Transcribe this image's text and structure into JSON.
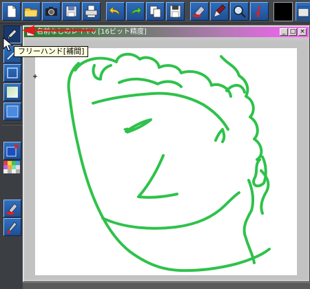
{
  "window": {
    "title": "名前なしのレイヤ0 [16ビット精度]",
    "minimize_glyph": "_",
    "maximize_glyph": "□",
    "close_glyph": "×"
  },
  "tooltip": {
    "text": "フリーハンド[補間]"
  },
  "toolbar": {
    "buttons": [
      {
        "icon": "new-document-icon"
      },
      {
        "icon": "open-folder-icon"
      },
      {
        "icon": "camera-icon"
      },
      {
        "icon": "save-disk-icon"
      },
      {
        "icon": "printer-icon"
      },
      {
        "icon": "undo-icon"
      },
      {
        "icon": "redo-icon"
      },
      {
        "icon": "copy-layer-icon"
      },
      {
        "icon": "save-layer-icon"
      },
      {
        "icon": "eraser-icon"
      },
      {
        "icon": "pen-icon"
      },
      {
        "icon": "magnifier-icon"
      },
      {
        "icon": "text-tool-icon"
      }
    ],
    "current_color": "#000000"
  },
  "tools": [
    {
      "icon": "freehand-pen-icon",
      "selected": true
    },
    {
      "icon": "line-tool-icon"
    },
    {
      "icon": "rectangle-tool-icon"
    },
    {
      "icon": "gradient-fill-icon"
    },
    {
      "icon": "filled-rectangle-icon"
    },
    {
      "icon": "new-layer-icon"
    },
    {
      "icon": "color-palette-icon"
    },
    {
      "icon": "brush-stamp-icon"
    },
    {
      "icon": "brush-tool-icon"
    }
  ],
  "colors": {
    "stroke": "#2ec24a",
    "annotation_arrow": "#e11b1b",
    "canvas": "#ffffff"
  }
}
